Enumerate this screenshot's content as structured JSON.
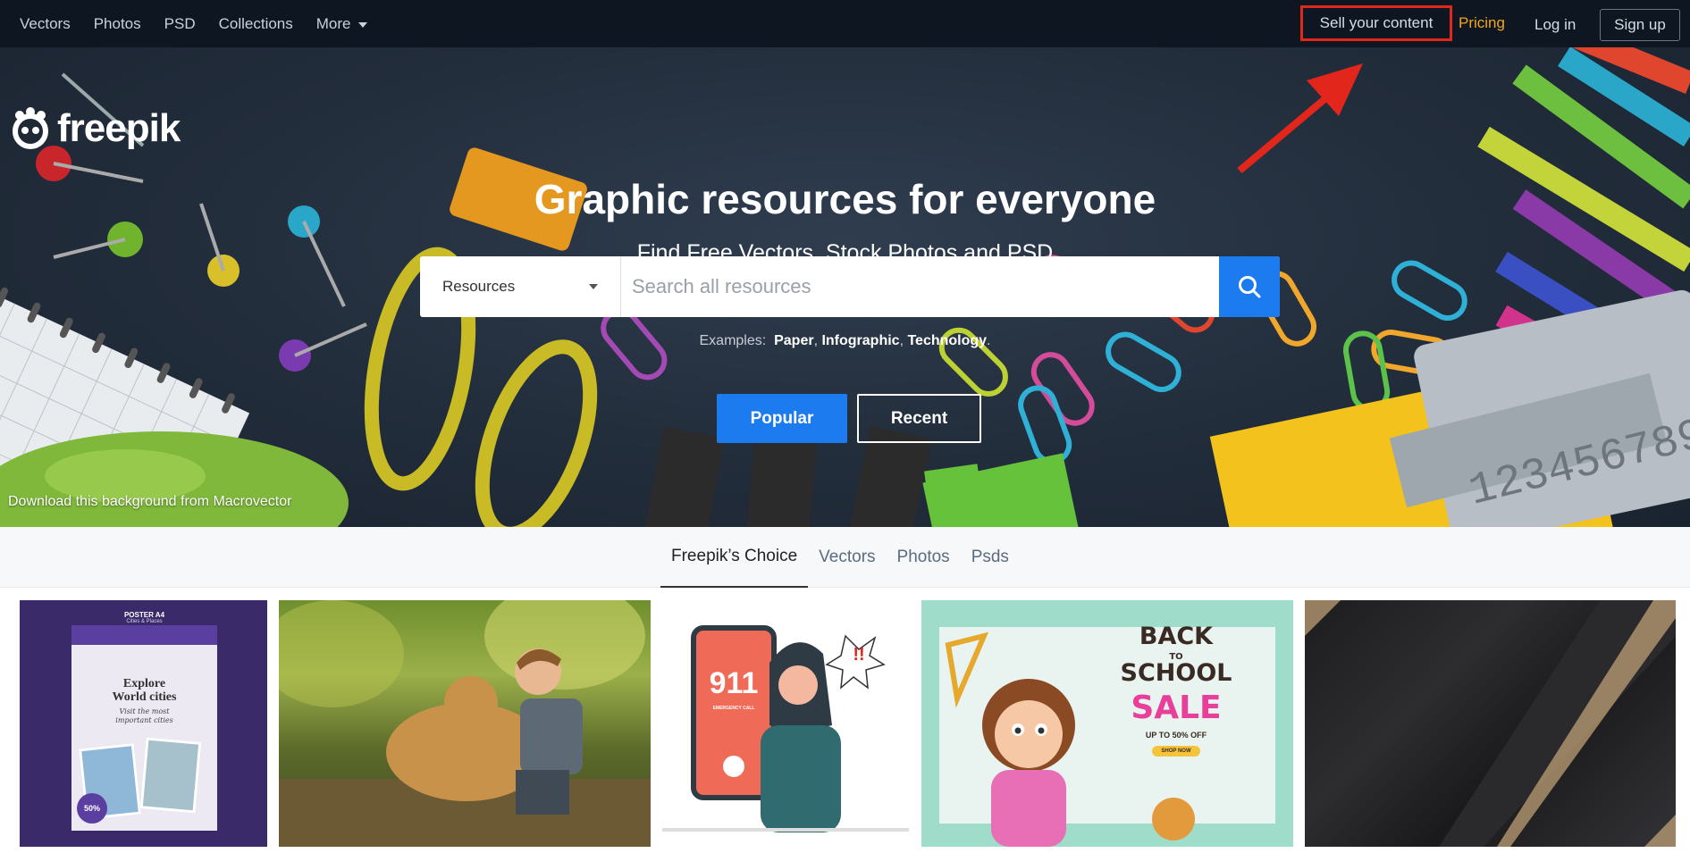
{
  "nav": {
    "left": [
      "Vectors",
      "Photos",
      "PSD",
      "Collections"
    ],
    "more": "More",
    "sell": "Sell your content",
    "pricing": "Pricing",
    "login": "Log in",
    "signup": "Sign up"
  },
  "brand": {
    "name": "freepik"
  },
  "hero": {
    "title": "Graphic resources for everyone",
    "subtitle": "Find Free Vectors, Stock Photos and PSD",
    "select_value": "Resources",
    "search_placeholder": "Search all resources",
    "examples_label": "Examples:",
    "examples": [
      "Paper",
      "Infographic",
      "Technology"
    ],
    "popular": "Popular",
    "recent": "Recent",
    "bg_credit": "Download this background from Macrovector"
  },
  "tabs": [
    "Freepik’s Choice",
    "Vectors",
    "Photos",
    "Psds"
  ],
  "thumbs": {
    "poster": {
      "header": "POSTER A4",
      "sub": "Cities & Places",
      "title1": "Explore",
      "title2": "World cities",
      "script1": "Visit the most",
      "script2": "important cities",
      "badge": "50%"
    },
    "emergency": {
      "number": "911",
      "caption": "EMERGENCY CALL",
      "alert": "!!"
    },
    "school": {
      "line1": "BACK",
      "line2": "TO",
      "line3": "SCHOOL",
      "line4": "SALE",
      "offer": "UP TO 50% OFF",
      "cta": "SHOP NOW"
    }
  },
  "colors": {
    "nav_bg": "#0e1621",
    "accent_blue": "#1d7bf0",
    "pricing_orange": "#f4a51c",
    "highlight_red": "#e3261b"
  }
}
